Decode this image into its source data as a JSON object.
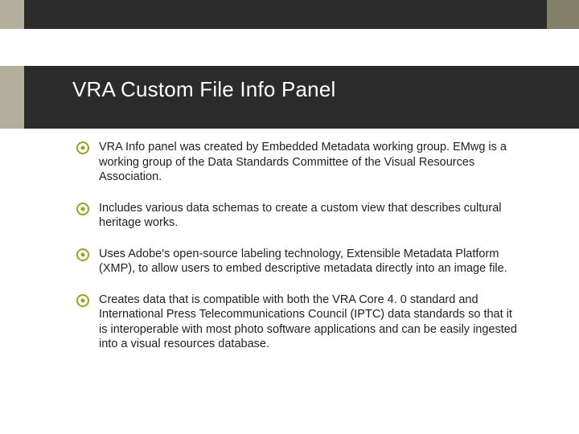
{
  "colors": {
    "accent": "#9aa515",
    "dark": "#2a2b2a",
    "tan": "#b2b09b",
    "olive": "#828069"
  },
  "slide": {
    "title": "VRA Custom File Info Panel",
    "bullets": [
      "VRA Info panel was created by Embedded Metadata working group. EMwg is a working group of the Data Standards Committee of the Visual Resources Association.",
      "Includes various data schemas to create a custom view that describes cultural heritage works.",
      "Uses Adobe's open-source labeling technology, Extensible Metadata Platform (XMP), to allow users to embed descriptive metadata directly into an image file.",
      "Creates data that is compatible with both the VRA Core 4. 0 standard and International Press Telecommunications Council (IPTC) data standards so that it is interoperable with most photo software applications and can be easily ingested into a visual resources database."
    ]
  }
}
